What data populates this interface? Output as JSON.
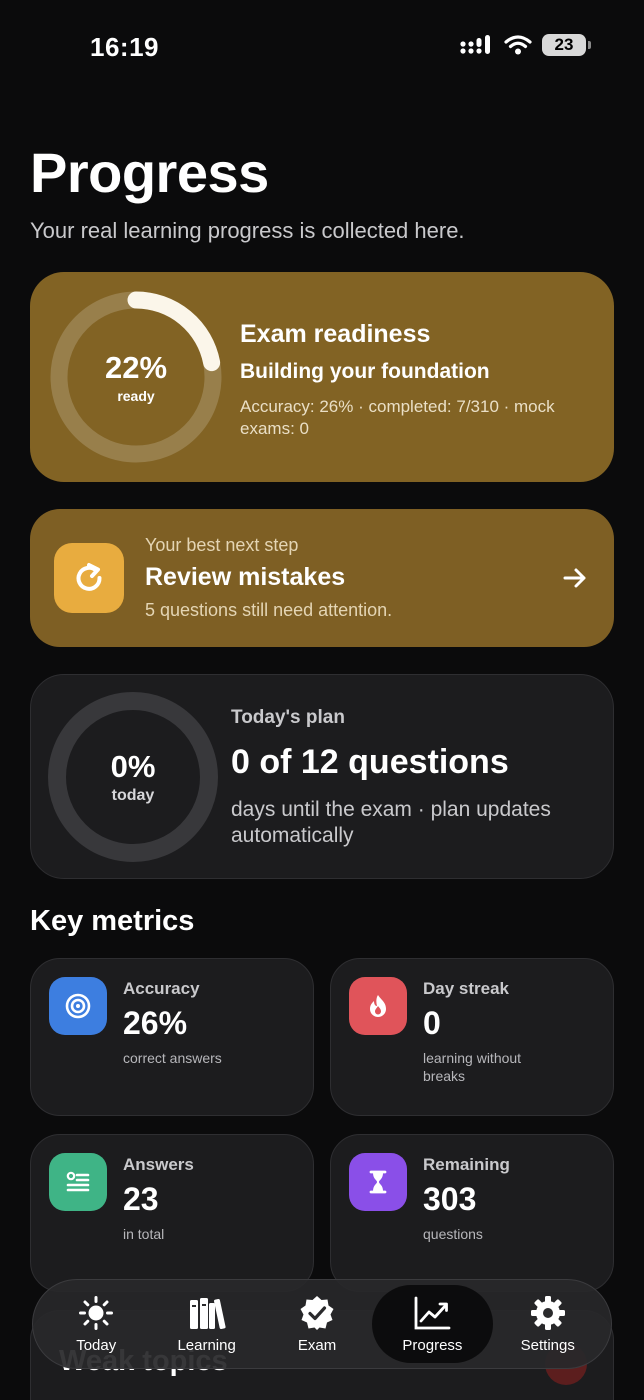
{
  "status_bar": {
    "time": "16:19",
    "battery": "23"
  },
  "header": {
    "title": "Progress",
    "subtitle": "Your real learning progress is collected here."
  },
  "readiness": {
    "percent_text": "22%",
    "percent_value": 22,
    "ring_label": "ready",
    "title": "Exam readiness",
    "subtitle": "Building your foundation",
    "stats": "Accuracy: 26% · completed: 7/310 · mock exams: 0"
  },
  "next_step": {
    "kicker": "Your best next step",
    "title": "Review mistakes",
    "description": "5 questions still need attention."
  },
  "plan": {
    "percent_text": "0%",
    "percent_value": 0,
    "ring_label": "today",
    "kicker": "Today's plan",
    "title": "0 of 12 questions",
    "description": "days until the exam · plan updates automatically"
  },
  "metrics": {
    "section_title": "Key metrics",
    "items": [
      {
        "label": "Accuracy",
        "value": "26%",
        "desc": "correct answers",
        "icon": "target-icon",
        "color": "#3d7ee0"
      },
      {
        "label": "Day streak",
        "value": "0",
        "desc": "learning without breaks",
        "icon": "flame-icon",
        "color": "#e0545a"
      },
      {
        "label": "Answers",
        "value": "23",
        "desc": "in total",
        "icon": "checklist-icon",
        "color": "#3fb486"
      },
      {
        "label": "Remaining",
        "value": "303",
        "desc": "questions",
        "icon": "hourglass-icon",
        "color": "#8a4fe8"
      }
    ]
  },
  "weak_topics": {
    "title": "Weak topics"
  },
  "tab_bar": {
    "tabs": [
      {
        "label": "Today",
        "icon": "sun-icon"
      },
      {
        "label": "Learning",
        "icon": "books-icon"
      },
      {
        "label": "Exam",
        "icon": "badge-check-icon"
      },
      {
        "label": "Progress",
        "icon": "chart-icon",
        "active": true
      },
      {
        "label": "Settings",
        "icon": "gear-icon"
      }
    ]
  },
  "colors": {
    "background": "#0b0b0c",
    "readiness_card": "#826324",
    "next_step_card": "#7e5f24",
    "next_step_icon": "#e8ac3f",
    "card": "#1c1c1e"
  }
}
